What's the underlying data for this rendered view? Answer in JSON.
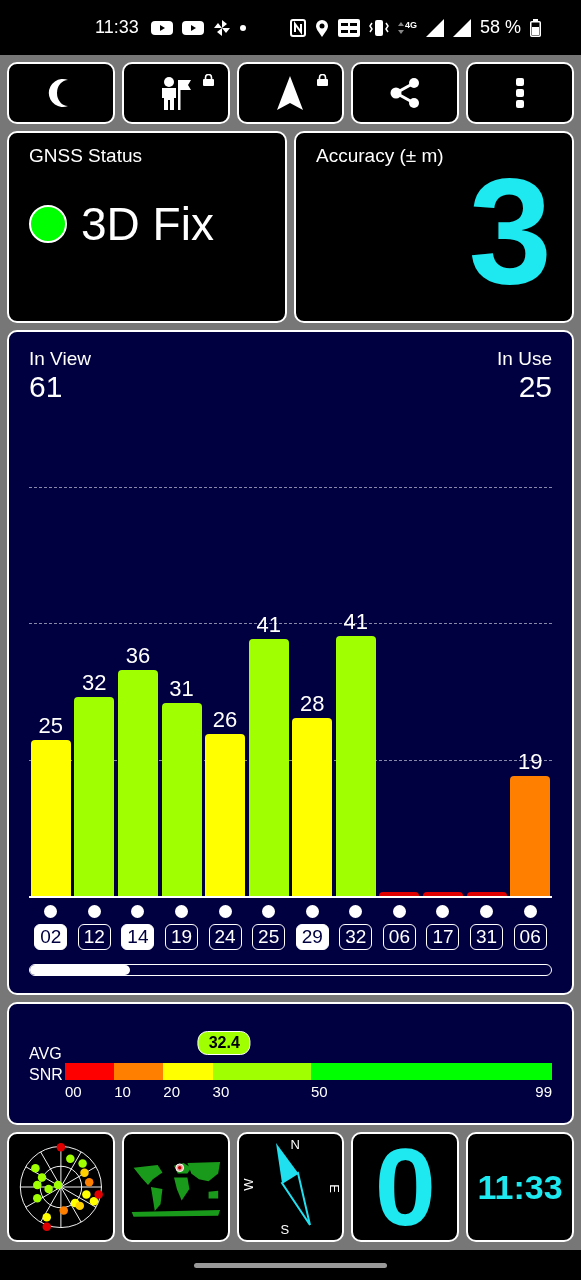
{
  "status_bar": {
    "time": "11:33",
    "network": "4G",
    "battery": "58 %"
  },
  "toolbar": [
    {
      "kind": "moon",
      "locked": false
    },
    {
      "kind": "person-flag",
      "locked": true
    },
    {
      "kind": "navigation",
      "locked": true
    },
    {
      "kind": "share",
      "locked": false
    },
    {
      "kind": "more",
      "locked": false
    }
  ],
  "gnss_status": {
    "label": "GNSS Status",
    "value": "3D Fix",
    "color": "#00ff00"
  },
  "accuracy": {
    "label": "Accuracy (± m)",
    "value": "3"
  },
  "satellites_panel": {
    "in_view_label": "In View",
    "in_view": "61",
    "in_use_label": "In Use",
    "in_use": "25"
  },
  "satellites": [
    {
      "snr": "25",
      "id": "02",
      "color": "#ffff00",
      "in_use": true
    },
    {
      "snr": "32",
      "id": "12",
      "color": "#a0ff00",
      "in_use": false
    },
    {
      "snr": "36",
      "id": "14",
      "color": "#a0ff00",
      "in_use": true
    },
    {
      "snr": "31",
      "id": "19",
      "color": "#a0ff00",
      "in_use": false
    },
    {
      "snr": "26",
      "id": "24",
      "color": "#ffff00",
      "in_use": false
    },
    {
      "snr": "41",
      "id": "25",
      "color": "#a0ff00",
      "in_use": false
    },
    {
      "snr": "28",
      "id": "29",
      "color": "#ffff00",
      "in_use": true
    },
    {
      "snr": "41",
      "id": "32",
      "color": "#a0ff00",
      "in_use": false
    },
    {
      "id": "06",
      "color": "#e00000",
      "in_use": false
    },
    {
      "id": "17",
      "color": "#e00000",
      "in_use": false
    },
    {
      "id": "31",
      "color": "#e00000",
      "in_use": false
    },
    {
      "snr": "19",
      "id": "06",
      "color": "#ff8000",
      "in_use": false
    }
  ],
  "avg_snr": {
    "label_1": "AVG",
    "label_2": "SNR",
    "value": "32.4",
    "level": 0.327,
    "end_label": "99",
    "segments": [
      {
        "label": "00",
        "color": "#ff0000"
      },
      {
        "label": "10",
        "color": "#ff8000"
      },
      {
        "label": "20",
        "color": "#ffff00"
      },
      {
        "label": "30",
        "color": "#a0ff00"
      },
      {
        "label": "50",
        "color": "#00ff00"
      }
    ]
  },
  "tiles": [
    {
      "kind": "skyplot"
    },
    {
      "kind": "map"
    },
    {
      "kind": "compass",
      "north": "N",
      "east": "E",
      "south": "S",
      "west": "W"
    },
    {
      "kind": "number",
      "value": "0"
    },
    {
      "kind": "clock",
      "value": "11:33"
    }
  ]
}
